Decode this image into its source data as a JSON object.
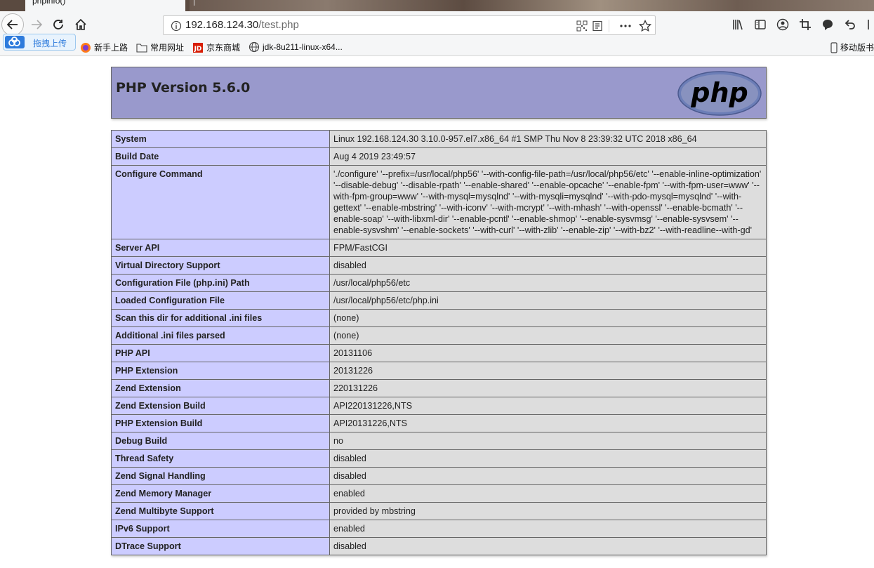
{
  "browser": {
    "tab_title": "phpinfo()",
    "url_host": "192.168.124.30",
    "url_path": "/test.php",
    "upload_label": "拖拽上传",
    "bookmarks": [
      "新手上路",
      "常用网址",
      "京东商城",
      "jdk-8u211-linux-x64..."
    ],
    "mobile_bookmarks": "移动版书",
    "icons": [
      "back-icon",
      "forward-icon",
      "reload-icon",
      "home-icon",
      "info-icon",
      "qr-icon",
      "reader-icon",
      "more-icon",
      "star-icon",
      "library-icon",
      "sidebar-icon",
      "account-icon",
      "crop-icon",
      "chat-icon",
      "undo-icon"
    ]
  },
  "page": {
    "title": "PHP Version 5.6.0",
    "logo_text": "php",
    "rows": [
      {
        "k": "System",
        "v": "Linux 192.168.124.30 3.10.0-957.el7.x86_64 #1 SMP Thu Nov 8 23:39:32 UTC 2018 x86_64"
      },
      {
        "k": "Build Date",
        "v": "Aug 4 2019 23:49:57"
      },
      {
        "k": "Configure Command",
        "v": "'./configure' '--prefix=/usr/local/php56' '--with-config-file-path=/usr/local/php56/etc' '--enable-inline-optimization' '--disable-debug' '--disable-rpath' '--enable-shared' '--enable-opcache' '--enable-fpm' '--with-fpm-user=www' '--with-fpm-group=www' '--with-mysql=mysqlnd' '--with-mysqli=mysqlnd' '--with-pdo-mysql=mysqlnd' '--with-gettext' '--enable-mbstring' '--with-iconv' '--with-mcrypt' '--with-mhash' '--with-openssl' '--enable-bcmath' '--enable-soap' '--with-libxml-dir' '--enable-pcntl' '--enable-shmop' '--enable-sysvmsg' '--enable-sysvsem' '--enable-sysvshm' '--enable-sockets' '--with-curl' '--with-zlib' '--enable-zip' '--with-bz2' '--with-readline--with-gd'"
      },
      {
        "k": "Server API",
        "v": "FPM/FastCGI"
      },
      {
        "k": "Virtual Directory Support",
        "v": "disabled"
      },
      {
        "k": "Configuration File (php.ini) Path",
        "v": "/usr/local/php56/etc"
      },
      {
        "k": "Loaded Configuration File",
        "v": "/usr/local/php56/etc/php.ini"
      },
      {
        "k": "Scan this dir for additional .ini files",
        "v": "(none)"
      },
      {
        "k": "Additional .ini files parsed",
        "v": "(none)"
      },
      {
        "k": "PHP API",
        "v": "20131106"
      },
      {
        "k": "PHP Extension",
        "v": "20131226"
      },
      {
        "k": "Zend Extension",
        "v": "220131226"
      },
      {
        "k": "Zend Extension Build",
        "v": "API220131226,NTS"
      },
      {
        "k": "PHP Extension Build",
        "v": "API20131226,NTS"
      },
      {
        "k": "Debug Build",
        "v": "no"
      },
      {
        "k": "Thread Safety",
        "v": "disabled"
      },
      {
        "k": "Zend Signal Handling",
        "v": "disabled"
      },
      {
        "k": "Zend Memory Manager",
        "v": "enabled"
      },
      {
        "k": "Zend Multibyte Support",
        "v": "provided by mbstring"
      },
      {
        "k": "IPv6 Support",
        "v": "enabled"
      },
      {
        "k": "DTrace Support",
        "v": "disabled"
      }
    ]
  }
}
